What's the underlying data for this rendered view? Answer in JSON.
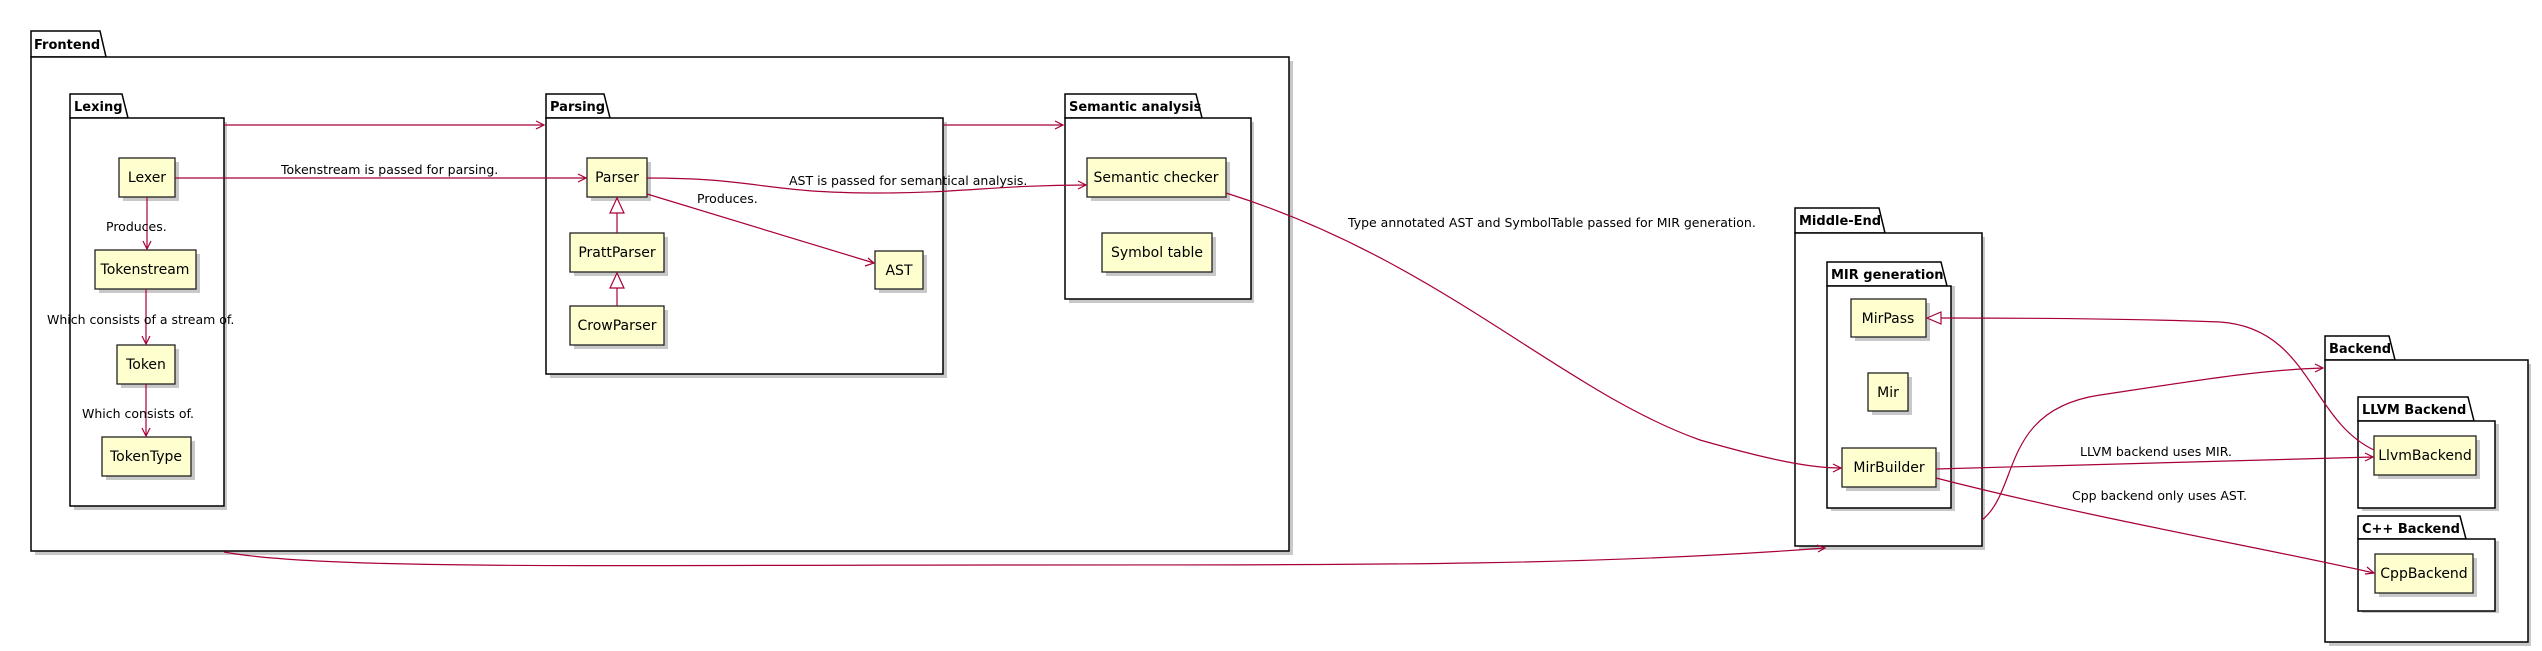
{
  "packages": {
    "frontend": "Frontend",
    "lexing": "Lexing",
    "parsing": "Parsing",
    "semantic": "Semantic analysis",
    "middle_end": "Middle-End",
    "mir_generation": "MIR generation",
    "backend": "Backend",
    "llvm_backend": "LLVM Backend",
    "cpp_backend": "C++ Backend"
  },
  "nodes": {
    "lexer": "Lexer",
    "tokenstream": "Tokenstream",
    "token": "Token",
    "tokentype": "TokenType",
    "parser": "Parser",
    "prattparser": "PrattParser",
    "crowparser": "CrowParser",
    "ast": "AST",
    "semantic_checker": "Semantic checker",
    "symbol_table": "Symbol table",
    "mirpass": "MirPass",
    "mir": "Mir",
    "mirbuilder": "MirBuilder",
    "llvmbackend": "LlvmBackend",
    "cppbackend": "CppBackend"
  },
  "edge_labels": {
    "lexer_tokenstream": "Produces.",
    "tokenstream_token": "Which consists of a stream of.",
    "token_tokentype": "Which consists of.",
    "lexer_parser": "Tokenstream is passed for parsing.",
    "parser_ast": "Produces.",
    "parser_semantic": "AST is passed for semantical analysis.",
    "semantic_mirbuilder": "Type annotated AST and SymbolTable passed for MIR generation.",
    "mirbuilder_llvm": "LLVM backend uses MIR.",
    "mirbuilder_cpp": "Cpp backend only uses AST."
  },
  "colors": {
    "node_fill": "#fefece",
    "node_border": "#222222",
    "edge": "#a80036",
    "package_border": "#000000"
  }
}
